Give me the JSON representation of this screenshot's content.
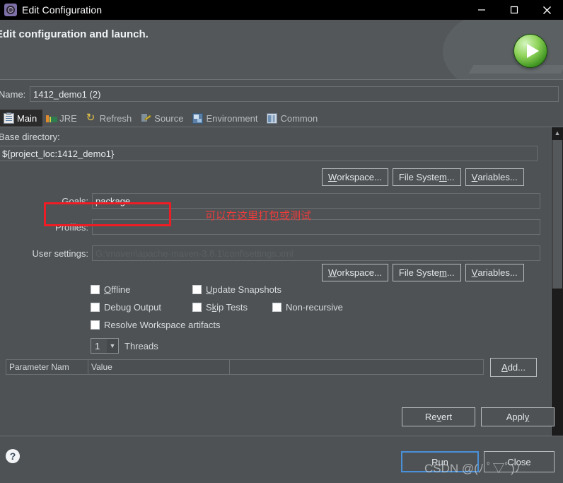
{
  "window": {
    "title": "Edit Configuration",
    "title_icon": "gear-config-icon",
    "controls": {
      "minimize": "minimize-icon",
      "maximize": "maximize-icon",
      "close": "close-icon"
    }
  },
  "header": {
    "title": "Edit configuration and launch.",
    "icon": "run-play-icon"
  },
  "name": {
    "label": "Name:",
    "value": "1412_demo1 (2)"
  },
  "tabs": [
    {
      "label": "Main",
      "icon": "main-tab-icon",
      "active": true
    },
    {
      "label": "JRE",
      "icon": "jre-tab-icon",
      "active": false
    },
    {
      "label": "Refresh",
      "icon": "refresh-tab-icon",
      "active": false
    },
    {
      "label": "Source",
      "icon": "source-tab-icon",
      "active": false
    },
    {
      "label": "Environment",
      "icon": "environment-tab-icon",
      "active": false
    },
    {
      "label": "Common",
      "icon": "common-tab-icon",
      "active": false
    }
  ],
  "main": {
    "base_directory": {
      "label": "Base directory:",
      "value": "${project_loc:1412_demo1}"
    },
    "dir_buttons": [
      {
        "label": "Workspace...",
        "mnemonic": "W"
      },
      {
        "label": "File System...",
        "mnemonic": "m"
      },
      {
        "label": "Variables...",
        "mnemonic": "V"
      }
    ],
    "goals": {
      "label": "Goals:",
      "value": "package"
    },
    "profiles": {
      "label": "Profiles:",
      "value": ""
    },
    "user_settings": {
      "label": "User settings:",
      "value": "",
      "placeholder": "G:\\maven\\apache-maven-3.8.1\\conf\\settings.xml"
    },
    "settings_buttons": [
      {
        "label": "Workspace...",
        "mnemonic": "W"
      },
      {
        "label": "File System...",
        "mnemonic": "m"
      },
      {
        "label": "Variables...",
        "mnemonic": "V"
      }
    ],
    "checkboxes": [
      {
        "label": "Offline",
        "checked": false,
        "mnemonic": "O"
      },
      {
        "label": "Update Snapshots",
        "checked": false,
        "mnemonic": "U"
      },
      {
        "label": "Debug Output",
        "checked": false,
        "mnemonic": "g"
      },
      {
        "label": "Skip Tests",
        "checked": false,
        "mnemonic": "k"
      },
      {
        "label": "Non-recursive",
        "checked": false,
        "mnemonic": ""
      },
      {
        "label": "Resolve Workspace artifacts",
        "checked": false,
        "mnemonic": ""
      }
    ],
    "threads": {
      "value": "1",
      "label": "Threads"
    },
    "parameters_table": {
      "columns": [
        "Parameter Nam",
        "Value",
        ""
      ],
      "rows": [],
      "add_button": "Add...",
      "add_mnemonic": "A"
    }
  },
  "annotation": {
    "text": "可以在这里打包或测试",
    "color": "#ef3b3b",
    "box_color": "#ee1c25"
  },
  "footer": {
    "revert": "Revert",
    "revert_mnemonic": "v",
    "apply": "Apply",
    "apply_mnemonic": "y",
    "run": "Run",
    "run_mnemonic": "R",
    "close": "Close",
    "close_mnemonic": "C",
    "help_icon": "help-question-icon",
    "watermark": "CSDN @(ﾉ ﾟ▽ﾟ)ﾉ"
  }
}
